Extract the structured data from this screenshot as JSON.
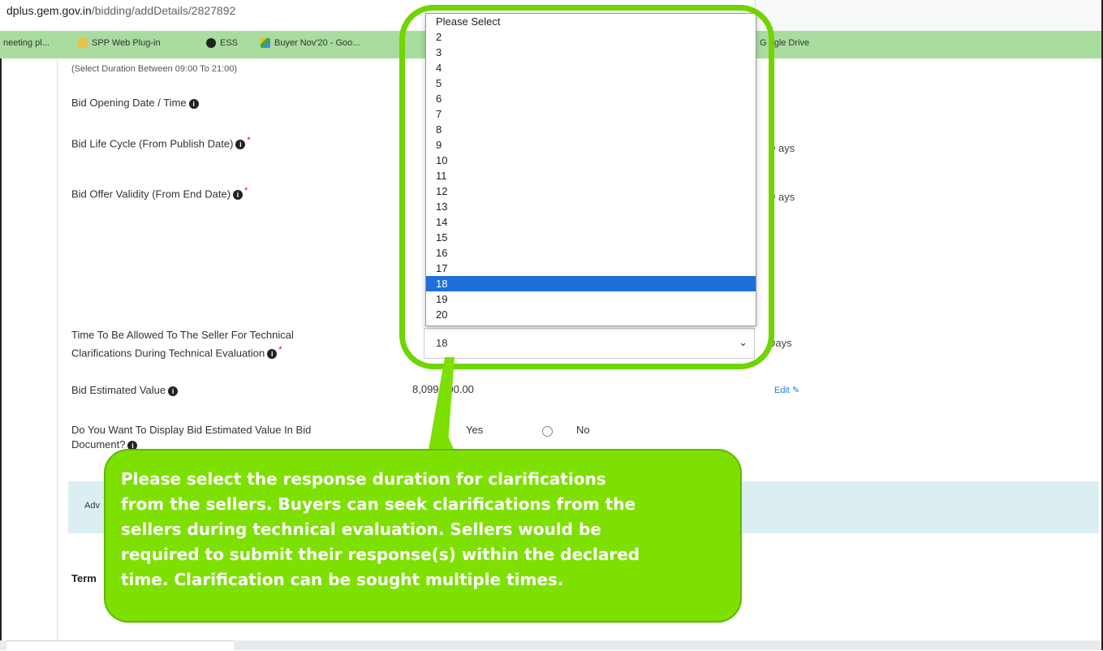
{
  "browser": {
    "url_host": "dplus.gem.gov.in",
    "url_path": "/bidding/addDetails/2827892",
    "bookmarks": [
      {
        "label": "neeting pl...",
        "icon": "bookmark-icon"
      },
      {
        "label": "SPP Web Plug-in",
        "icon": "link-icon"
      },
      {
        "label": "ESS",
        "icon": "web-icon"
      },
      {
        "label": "Buyer Nov'20 - Goo...",
        "icon": "google-drive-icon"
      },
      {
        "label": "G  ogle Drive",
        "icon": "google-drive-icon"
      }
    ]
  },
  "form": {
    "duration_note": "(Select Duration Between 09:00 To 21:00)",
    "bid_opening_label": "Bid Opening Date / Time",
    "bid_life_cycle_label": "Bid Life Cycle (From Publish Date)",
    "bid_life_cycle_unit": "D  ays",
    "bid_offer_validity_label": "Bid Offer Validity (From End Date)",
    "bid_offer_validity_unit": "D  ays",
    "tech_clar_label_line1": "Time To Be Allowed To The Seller For Technical",
    "tech_clar_label_line2": "Clarifications During Technical Evaluation",
    "tech_clar_selected": "18",
    "tech_clar_unit": "Days",
    "estimated_value_label": "Bid Estimated Value",
    "estimated_value": "8,099,000.00",
    "edit_label": "Edit",
    "display_value_label_line1": "Do You Want To Display Bid Estimated Value In Bid",
    "display_value_label_line2": "Document?",
    "yes_label": "Yes",
    "no_label": "No",
    "advanced_band_text": "Adv",
    "terms_text": "Term"
  },
  "dropdown": {
    "options": [
      "Please Select",
      "2",
      "3",
      "4",
      "5",
      "6",
      "7",
      "8",
      "9",
      "10",
      "11",
      "12",
      "13",
      "14",
      "15",
      "16",
      "17",
      "18",
      "19",
      "20"
    ],
    "selected_value": "18"
  },
  "callout": {
    "text": "Please select the response duration  for clarifications\nfrom the sellers. Buyers can seek clarifications from the\nsellers during technical evaluation. Sellers would be\nrequired to submit their response(s) within the declared\ntime.  Clarification can be sought multiple times."
  },
  "colors": {
    "highlight": "#6fd400",
    "callout_bg": "#7ee000",
    "selected_option": "#1e6fd9",
    "bookmark_bar": "#a9dc9f"
  }
}
